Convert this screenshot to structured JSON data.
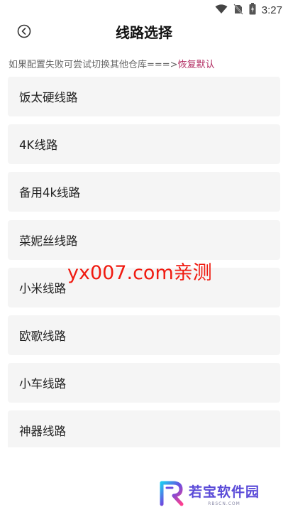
{
  "status_bar": {
    "time": "3:27",
    "icons": [
      "wifi-icon",
      "no-sim-icon",
      "battery-icon"
    ]
  },
  "header": {
    "title": "线路选择",
    "back_icon": "back-circle-icon"
  },
  "hint": {
    "text": "如果配置失败可尝试切换其他仓库===>",
    "link": "恢复默认",
    "link_color": "#b0275e"
  },
  "routes": [
    "饭太硬线路",
    "4K线路",
    "备用4k线路",
    "菜妮丝线路",
    "小米线路",
    "欧歌线路",
    "小车线路",
    "神器线路"
  ],
  "watermark": {
    "text": "yx007.com亲测",
    "color": "#f01a10"
  },
  "logo": {
    "name": "若宝软件园",
    "domain": "RBSCN.COM"
  }
}
